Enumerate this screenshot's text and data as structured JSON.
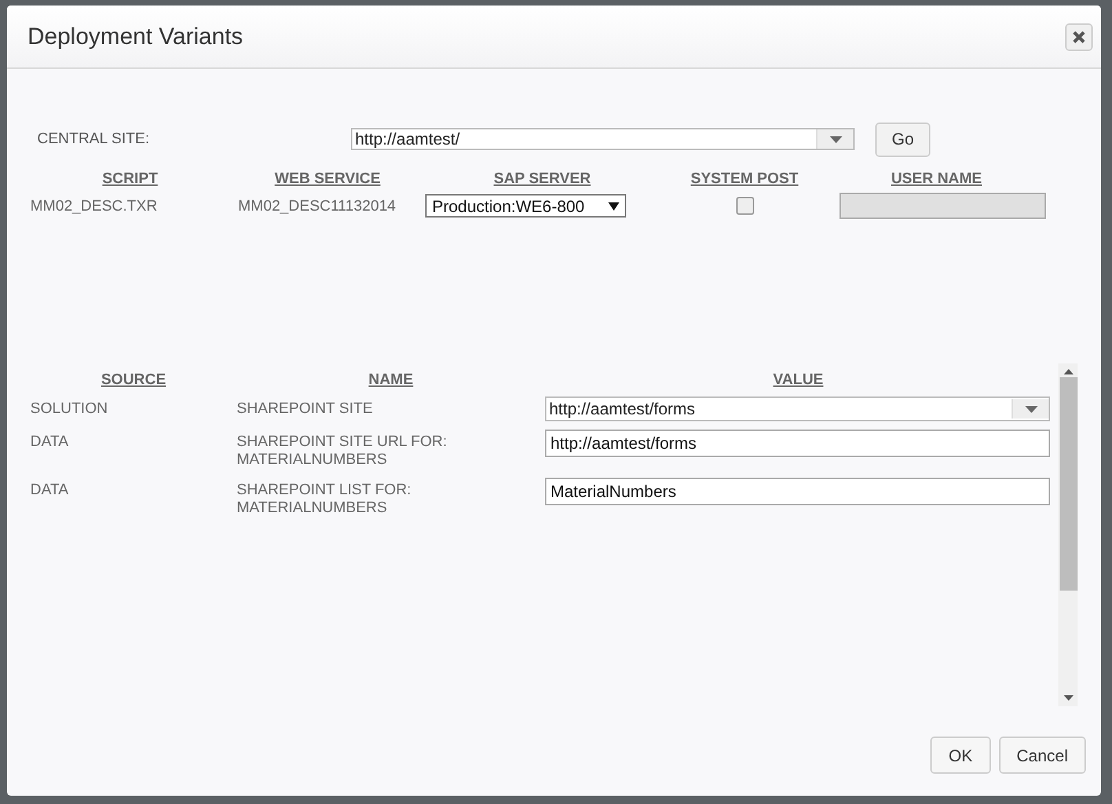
{
  "window": {
    "title": "Deployment Variants"
  },
  "central_site": {
    "label": "CENTRAL SITE:",
    "value": "http://aamtest/",
    "button": "Go"
  },
  "variants": {
    "columns": [
      "SCRIPT",
      "WEB SERVICE",
      "SAP SERVER",
      "SYSTEM POST",
      "USER NAME"
    ],
    "rows": [
      {
        "script": "MM02_DESC.TXR",
        "web_service": "MM02_DESC11132014",
        "sap_server": "Production:WE6-800",
        "system_post": false
      }
    ]
  },
  "parameters": {
    "columns": [
      "SOURCE",
      "NAME",
      "VALUE"
    ],
    "rows": [
      {
        "source": "SOLUTION",
        "name": "SHAREPOINT SITE",
        "kind": "dropdown",
        "value": "http://aamtest/forms"
      },
      {
        "source": "DATA",
        "name": "SHAREPOINT SITE URL FOR: MATERIALNUMBERS",
        "kind": "text",
        "value": "http://aamtest/forms"
      },
      {
        "source": "DATA",
        "name": "SHAREPOINT LIST FOR: MATERIALNUMBERS",
        "kind": "text",
        "value": "MaterialNumbers"
      }
    ]
  },
  "buttons": [
    "OK",
    "Cancel"
  ]
}
